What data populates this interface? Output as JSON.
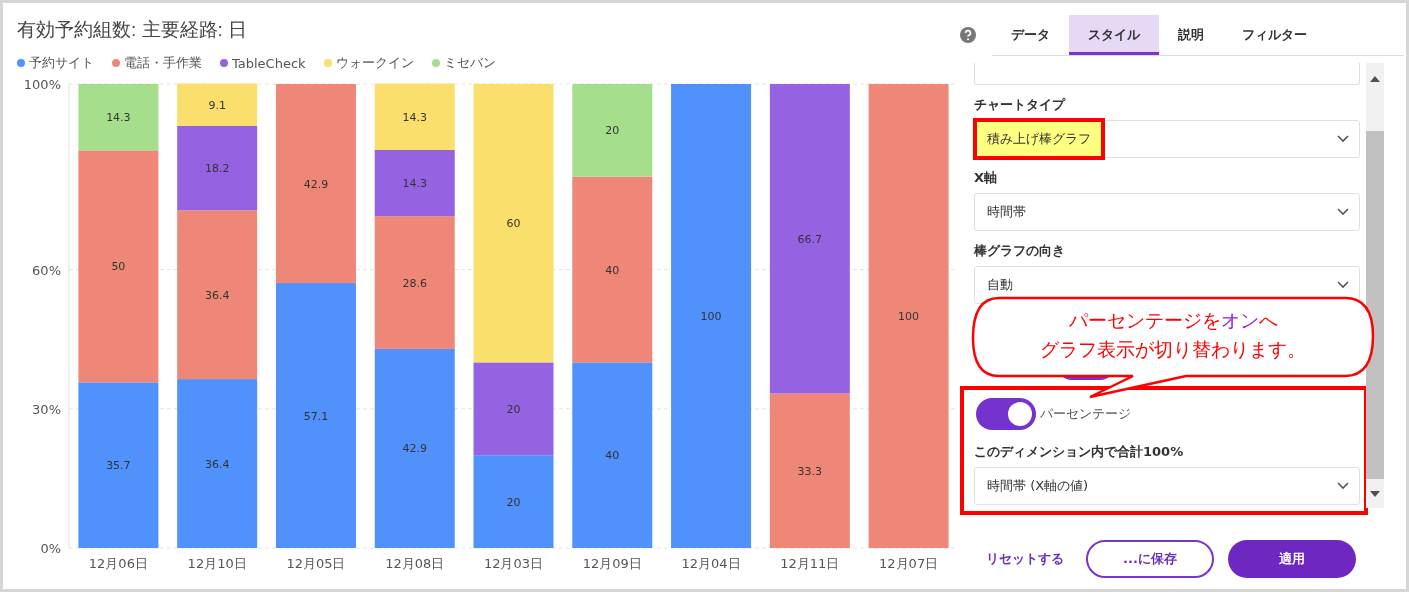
{
  "title": "有効予約組数: 主要経路: 日",
  "chart_data": {
    "type": "bar",
    "stacked": true,
    "orientation": "vertical",
    "data_labels": true,
    "ylim": [
      0,
      100
    ],
    "yticks": [
      {
        "value": 0,
        "label": "0%"
      },
      {
        "value": 30,
        "label": "30%"
      },
      {
        "value": 60,
        "label": "60%"
      },
      {
        "value": 100,
        "label": "100%"
      }
    ],
    "categories": [
      "12月06日",
      "12月10日",
      "12月05日",
      "12月08日",
      "12月03日",
      "12月09日",
      "12月04日",
      "12月11日",
      "12月07日"
    ],
    "series": [
      {
        "name": "予約サイト",
        "color": "#5191fb",
        "values": [
          35.7,
          36.4,
          57.1,
          42.9,
          20,
          40,
          100,
          null,
          null
        ]
      },
      {
        "name": "電話・手作業",
        "color": "#ef8778",
        "values": [
          50,
          36.4,
          42.9,
          28.6,
          null,
          40,
          null,
          33.3,
          100
        ]
      },
      {
        "name": "TableCheck",
        "color": "#9563e1",
        "values": [
          null,
          18.2,
          null,
          14.3,
          20,
          null,
          null,
          66.7,
          null
        ]
      },
      {
        "name": "ウォークイン",
        "color": "#fbdf6c",
        "values": [
          null,
          9.1,
          null,
          14.3,
          60,
          null,
          null,
          null,
          null
        ]
      },
      {
        "name": "ミセバン",
        "color": "#a6df8c",
        "values": [
          14.3,
          null,
          null,
          null,
          null,
          20,
          null,
          null,
          null
        ]
      }
    ]
  },
  "tabs": [
    {
      "label": "データ",
      "selected": false
    },
    {
      "label": "スタイル",
      "selected": true
    },
    {
      "label": "説明",
      "selected": false
    },
    {
      "label": "フィルター",
      "selected": false
    }
  ],
  "sections": [
    {
      "highlighted": false,
      "items": [
        {
          "kind": "select"
        },
        {
          "kind": "label",
          "text": "チャートタイプ"
        },
        {
          "kind": "select",
          "value": "積み上げ棒グラフ",
          "highlighted": true
        },
        {
          "kind": "label",
          "text": "X軸"
        },
        {
          "kind": "select",
          "value": "時間帯",
          "highlighted": false
        },
        {
          "kind": "label",
          "text": "棒グラフの向き"
        },
        {
          "kind": "select",
          "value": "自動",
          "highlighted": false
        },
        {
          "kind": "toggle",
          "on": true
        }
      ]
    },
    {
      "highlighted": true,
      "items": [
        {
          "kind": "toggle",
          "on": true,
          "label": "パーセンテージ"
        },
        {
          "kind": "label",
          "text": "このディメンション内で合計100%"
        },
        {
          "kind": "select",
          "value": "時間帯 (X軸の値)",
          "highlighted": false
        }
      ]
    }
  ],
  "callout": {
    "lines": [
      "パーセンテージを**オン**へ",
      "グラフ表示が切り替わります。"
    ]
  },
  "buttons": [
    {
      "label": "リセットする",
      "kind": "link"
    },
    {
      "label": "...に保存",
      "kind": "outline"
    },
    {
      "label": "適用",
      "kind": "primary"
    }
  ]
}
